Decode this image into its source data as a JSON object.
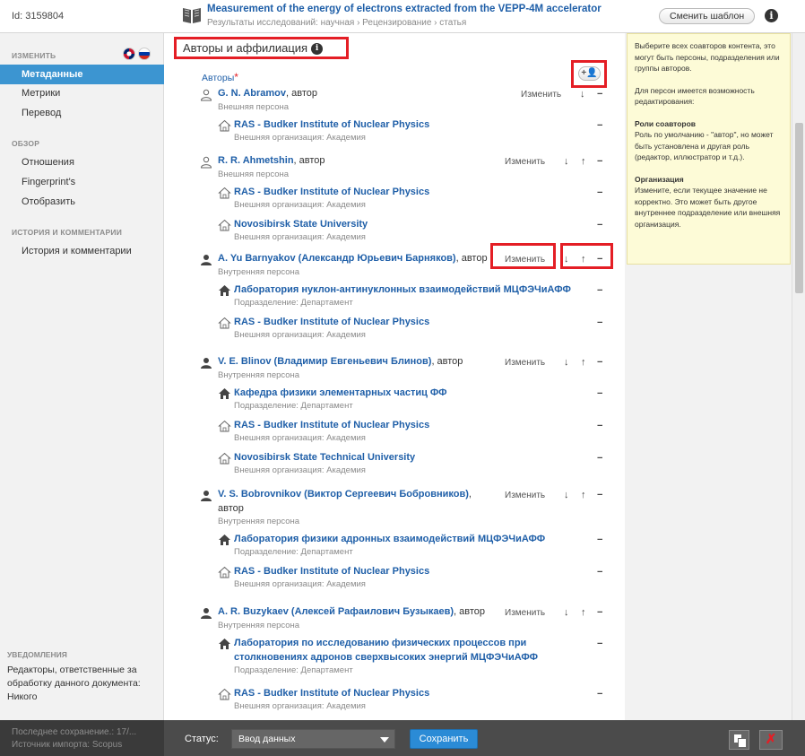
{
  "header": {
    "doc_id": "Id: 3159804",
    "title": "Measurement of the energy of electrons extracted from the VEPP-4M accelerator",
    "subtitle": "Результаты исследований: научная › Рецензирование › статья",
    "change_template": "Сменить шаблон",
    "info": "i"
  },
  "sidebar": {
    "edit_heading": "ИЗМЕНИТЬ",
    "edit_items": [
      "Метаданные",
      "Метрики",
      "Перевод"
    ],
    "review_heading": "ОБЗОР",
    "review_items": [
      "Отношения",
      "Fingerprint's",
      "Отобразить"
    ],
    "history_heading": "ИСТОРИЯ И КОММЕНТАРИИ",
    "history_items": [
      "История и комментарии"
    ],
    "notif_heading": "УВЕДОМЛЕНИЯ",
    "notif_text": "Редакторы, ответственные за обработку данного документа: Никого"
  },
  "main": {
    "section_title": "Авторы и аффилиация",
    "authors_label": "Авторы",
    "required_mark": "*",
    "add_label": "+👤",
    "edit_label": "Изменить",
    "down": "↓",
    "up": "↑",
    "remove": "−",
    "persons": [
      {
        "name": "G. N. Abramov",
        "role": ", автор",
        "type": "Внешняя персона",
        "orgs": [
          {
            "name": "RAS - Budker Institute of Nuclear Physics",
            "type": "Внешняя организация: Академия"
          }
        ]
      },
      {
        "name": "R. R. Ahmetshin",
        "role": ", автор",
        "type": "Внешняя персона",
        "orgs": [
          {
            "name": "RAS - Budker Institute of Nuclear Physics",
            "type": "Внешняя организация: Академия"
          },
          {
            "name": "Novosibirsk State University",
            "type": "Внешняя организация: Академия"
          }
        ]
      },
      {
        "name": "A. Yu Barnyakov (Александр Юрьевич Барняков)",
        "role": ", автор",
        "type": "Внутренняя персона",
        "orgs": [
          {
            "name": "Лаборатория нуклон-антинуклонных взаимодействий МЦФЭЧиАФФ",
            "type": "Подразделение: Департамент"
          },
          {
            "name": "RAS - Budker Institute of Nuclear Physics",
            "type": "Внешняя организация: Академия"
          }
        ]
      },
      {
        "name": "V. E. Blinov (Владимир Евгеньевич Блинов)",
        "role": ", автор",
        "type": "Внутренняя персона",
        "orgs": [
          {
            "name": "Кафедра физики элементарных частиц ФФ",
            "type": "Подразделение: Департамент"
          },
          {
            "name": "RAS - Budker Institute of Nuclear Physics",
            "type": "Внешняя организация: Академия"
          },
          {
            "name": "Novosibirsk State Technical University",
            "type": "Внешняя организация: Академия"
          }
        ]
      },
      {
        "name": "V. S. Bobrovnikov (Виктор Сергеевич Бобровников)",
        "role": ",",
        "role2": "автор",
        "type": "Внутренняя персона",
        "orgs": [
          {
            "name": "Лаборатория физики адронных взаимодействий МЦФЭЧиАФФ",
            "type": "Подразделение: Департамент"
          },
          {
            "name": "RAS - Budker Institute of Nuclear Physics",
            "type": "Внешняя организация: Академия"
          }
        ]
      },
      {
        "name": "A. R. Buzykaev (Алексей Рафаилович Бузыкаев)",
        "role": ", автор",
        "type": "Внутренняя персона",
        "orgs": [
          {
            "name": "Лаборатория по исследованию физических процессов при",
            "name2": "столкновениях адронов сверхвысоких энергий МЦФЭЧиАФФ",
            "type": "Подразделение: Департамент"
          },
          {
            "name": "RAS - Budker Institute of Nuclear Physics",
            "type": "Внешняя организация: Академия"
          }
        ]
      }
    ]
  },
  "help": {
    "intro": "Выберите всех соавторов контента, это могут быть персоны, подразделения или группы авторов.",
    "editable": "Для персон имеется возможность редактирования:",
    "roles_title": "Роли соавторов",
    "roles_text": "Роль по умолчанию - \"автор\", но может быть установлена и другая роль (редактор, иллюстратор и т.д.).",
    "org_title": "Организация",
    "org_text": "Измените, если текущее значение не корректно. Это может быть другое внутреннее подразделение или внешняя организация."
  },
  "footer": {
    "last_saved": "Последнее сохранение.: 17/...",
    "import_source": "Источник импорта: Scopus",
    "status_label": "Статус:",
    "status_value": "Ввод данных",
    "save": "Сохранить",
    "close": "✗"
  },
  "colors": {
    "accent": "#3c95d1",
    "link": "#1f5fa8",
    "highlight": "#e41e25",
    "help_bg": "#fdfbd7"
  }
}
